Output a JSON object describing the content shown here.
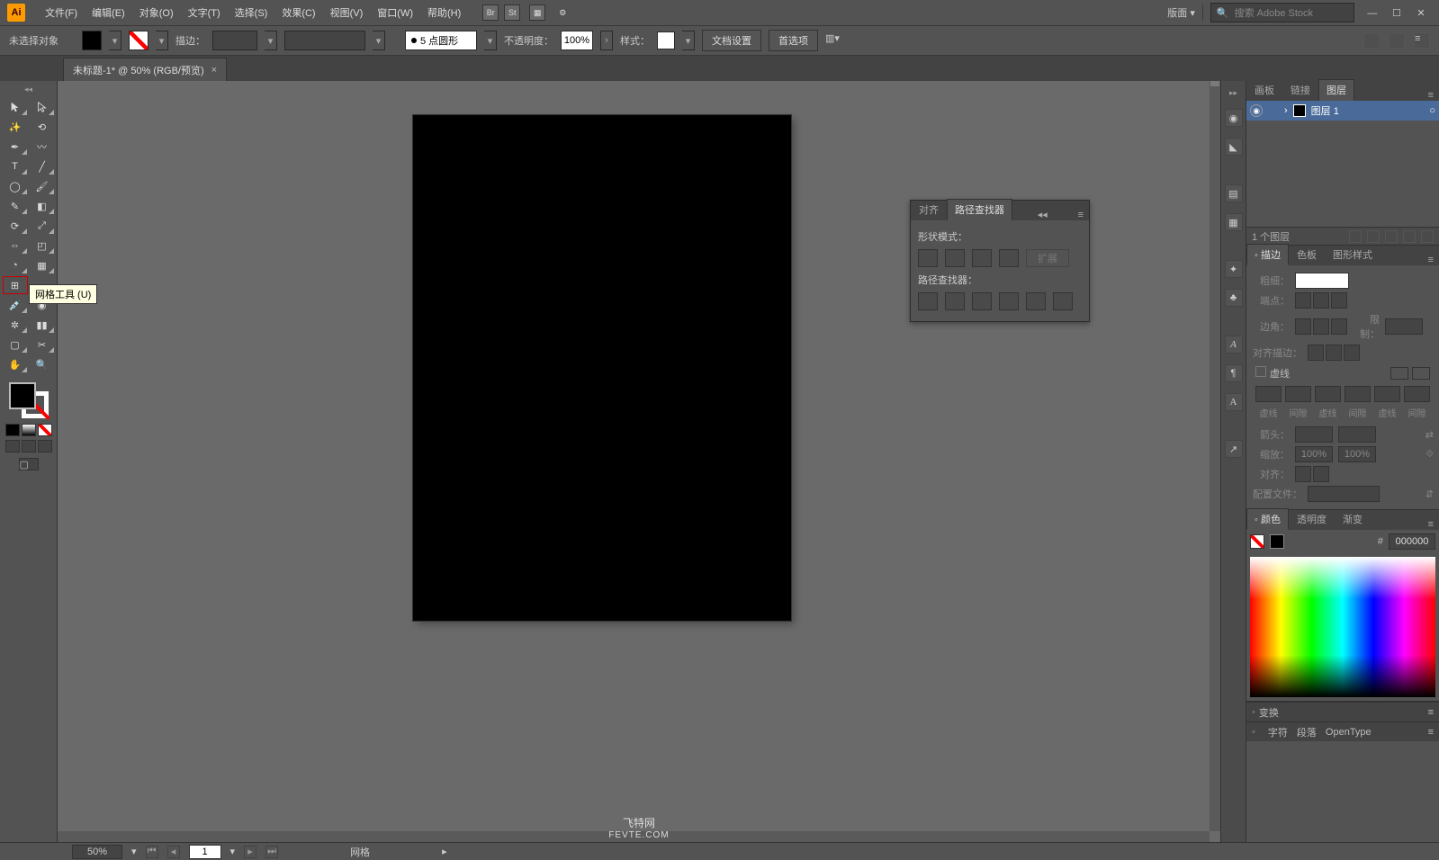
{
  "app": {
    "logo_text": "Ai"
  },
  "menubar": {
    "items": [
      "文件(F)",
      "编辑(E)",
      "对象(O)",
      "文字(T)",
      "选择(S)",
      "效果(C)",
      "视图(V)",
      "窗口(W)",
      "帮助(H)"
    ],
    "bridge_icons": [
      "Br",
      "St"
    ],
    "workspace_label": "版面",
    "search_placeholder": "搜索 Adobe Stock"
  },
  "ctrlbar": {
    "no_selection": "未选择对象",
    "stroke_label": "描边：",
    "stroke_size": "",
    "profile_value": "5 点圆形",
    "opacity_label": "不透明度：",
    "opacity_value": "100%",
    "style_label": "样式：",
    "doc_setup": "文档设置",
    "prefs": "首选项"
  },
  "tab": {
    "title": "未标题-1* @ 50% (RGB/预览)"
  },
  "tooltip": "网格工具 (U)",
  "float_panel": {
    "tabs": [
      "对齐",
      "路径查找器"
    ],
    "section1": "形状模式：",
    "expand": "扩展",
    "section2": "路径查找器："
  },
  "right_tabs": {
    "layers_group": [
      "画板",
      "链接",
      "图层"
    ],
    "layer_name": "图层 1",
    "layer_count": "1 个图层",
    "stroke_group": [
      "描边",
      "色板",
      "图形样式"
    ],
    "stroke": {
      "weight": "粗细：",
      "cap": "端点：",
      "corner": "边角：",
      "limit": "限制：",
      "align": "对齐描边：",
      "dashed": "虚线",
      "dash_labels": [
        "虚线",
        "间隙",
        "虚线",
        "间隙",
        "虚线",
        "间隙"
      ],
      "arrow": "箭头：",
      "scale": "缩放：",
      "scale_val": "100%",
      "align2": "对齐：",
      "profile": "配置文件："
    },
    "color_group": [
      "颜色",
      "透明度",
      "渐变"
    ],
    "color_hash": "#",
    "color_hex": "000000",
    "transform": "变换",
    "char_group": [
      "字符",
      "段落",
      "OpenType"
    ]
  },
  "statusbar": {
    "zoom": "50%",
    "page": "1",
    "tool": "网格"
  },
  "watermark": {
    "line1": "飞特网",
    "line2": "FEVTE.COM"
  }
}
